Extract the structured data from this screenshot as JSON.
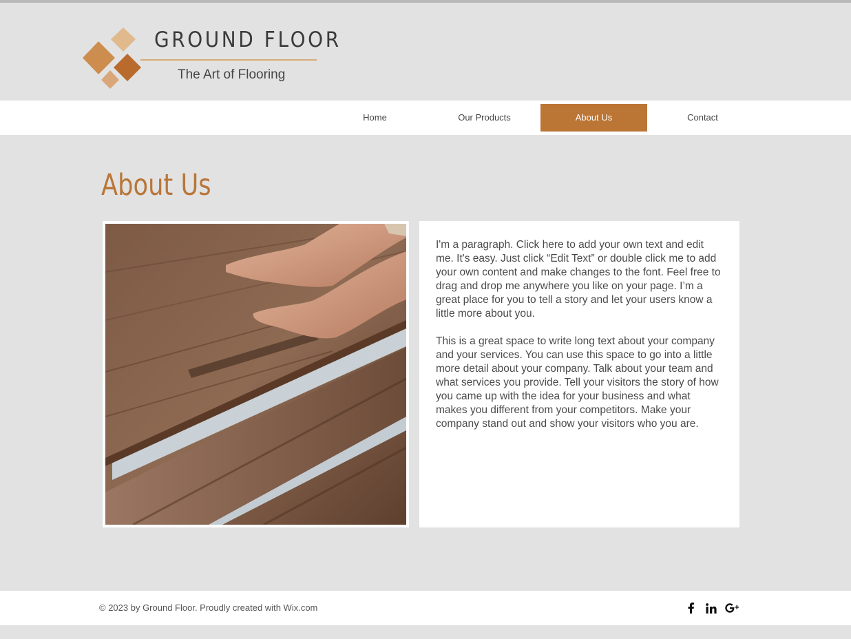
{
  "brand": {
    "title": "GROUND FLOOR",
    "tagline": "The Art of Flooring",
    "colors": {
      "accent": "#bb7535",
      "logo_light": "#e0b98c",
      "logo_mid": "#cc8d4e",
      "logo_dark": "#b86b2c"
    }
  },
  "nav": {
    "items": [
      {
        "label": "Home"
      },
      {
        "label": "Our Products"
      },
      {
        "label": "About Us",
        "active": true
      },
      {
        "label": "Contact"
      }
    ]
  },
  "main": {
    "heading": "About Us",
    "image_alt_icon": "flooring-installation-photo",
    "paragraphs": [
      "I'm a paragraph. Click here to add your own text and edit me. It's easy. Just click “Edit Text” or double click me to add your own content and make changes to the font. Feel free to drag and drop me anywhere you like on your page. I’m a great place for you to tell a story and let your users know a little more about you.",
      "This is a great space to write long text about your company and your services. You can use this space to go into a little more detail about your company. Talk about your team and what services you provide. Tell your visitors the story of how you came up with the idea for your business and what makes you different from your competitors. Make your company stand out and show your visitors who you are."
    ]
  },
  "footer": {
    "copyright": "© 2023 by Ground Floor. Proudly created with Wix.com",
    "social_icons": [
      "facebook-icon",
      "linkedin-icon",
      "google-plus-icon"
    ]
  }
}
